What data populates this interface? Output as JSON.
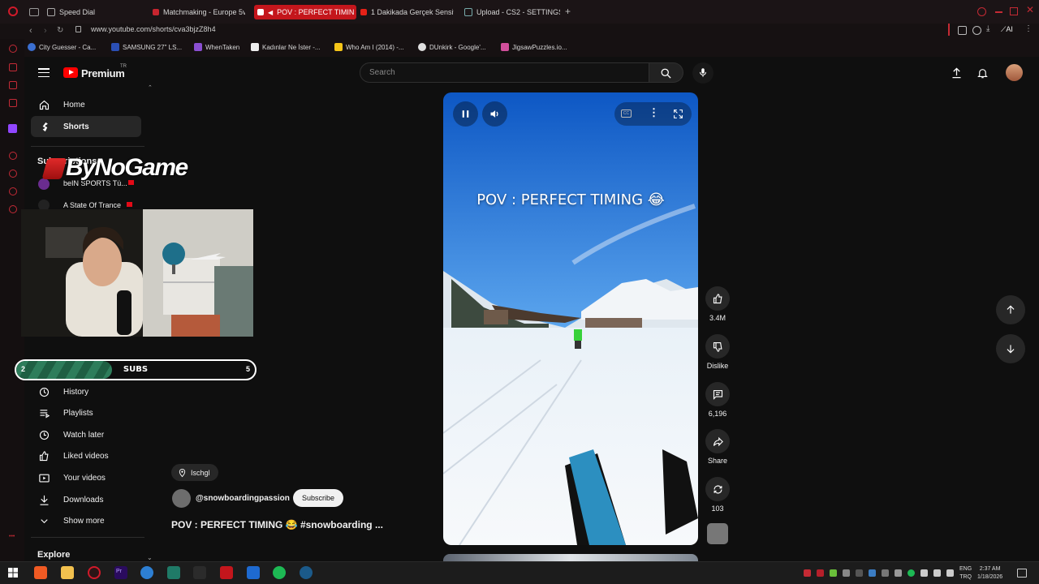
{
  "browser": {
    "tabs": [
      {
        "label": "Speed Dial",
        "active": false
      },
      {
        "label": "Matchmaking - Europe 5v",
        "active": false
      },
      {
        "label": "POV : PERFECT TIMIN",
        "active": true
      },
      {
        "label": "1 Dakikada Gerçek Sensit",
        "active": false
      },
      {
        "label": "Upload - CS2 - SETTINGS",
        "active": false
      }
    ],
    "new_tab_label": "+",
    "url": "www.youtube.com/shorts/cva3bjzZ8h4",
    "ai_label": "AI",
    "bookmarks": [
      {
        "label": "City Guesser - Ca...",
        "color": "#3b6fd1"
      },
      {
        "label": "SAMSUNG 27\" LS...",
        "color": "#2b4fb4"
      },
      {
        "label": "WhenTaken",
        "color": "#8a4fd1"
      },
      {
        "label": "Kadınlar Ne İster -...",
        "color": "#eeeeee"
      },
      {
        "label": "Who Am I (2014) -...",
        "color": "#f5c518"
      },
      {
        "label": "DUnkirk - Google'...",
        "color": "#e0e0e0"
      },
      {
        "label": "JigsawPuzzles.io...",
        "color": "#d14f9b"
      }
    ]
  },
  "youtube": {
    "logo_text": "Premium",
    "logo_region": "TR",
    "search_placeholder": "Search",
    "sidebar": {
      "main": [
        {
          "label": "Home",
          "icon": "home-icon"
        },
        {
          "label": "Shorts",
          "icon": "shorts-icon",
          "active": true
        }
      ],
      "subscriptions_title": "Subscriptions",
      "subscriptions": [
        "beIN SPORTS Tü...",
        "A State Of Trance"
      ],
      "you": [
        {
          "label": "History",
          "icon": "history-icon"
        },
        {
          "label": "Playlists",
          "icon": "playlists-icon"
        },
        {
          "label": "Watch later",
          "icon": "watch-later-icon"
        },
        {
          "label": "Liked videos",
          "icon": "like-icon"
        },
        {
          "label": "Your videos",
          "icon": "your-videos-icon"
        },
        {
          "label": "Downloads",
          "icon": "download-icon"
        },
        {
          "label": "Show more",
          "icon": "chevron-down-icon"
        }
      ],
      "explore_title": "Explore"
    },
    "short": {
      "overlay_title": "POV : PERFECT TIMING 😂",
      "location": "Ischgl",
      "channel": "@snowboardingpassion",
      "subscribe_label": "Subscribe",
      "caption": "POV : PERFECT TIMING 😂 #snowboarding ..."
    },
    "actions": {
      "like_count": "3.4M",
      "dislike_label": "Dislike",
      "comment_count": "6,196",
      "share_label": "Share",
      "remix_count": "103"
    }
  },
  "stream_overlay": {
    "brand": "ByNoGame",
    "subs_goal": {
      "current": "2",
      "label": "SUBS",
      "target": "5",
      "progress": 0.4
    }
  },
  "taskbar": {
    "lang_top": "ENG",
    "lang_bottom": "TRQ",
    "time": "2:37 AM",
    "date": "1/18/2026"
  }
}
